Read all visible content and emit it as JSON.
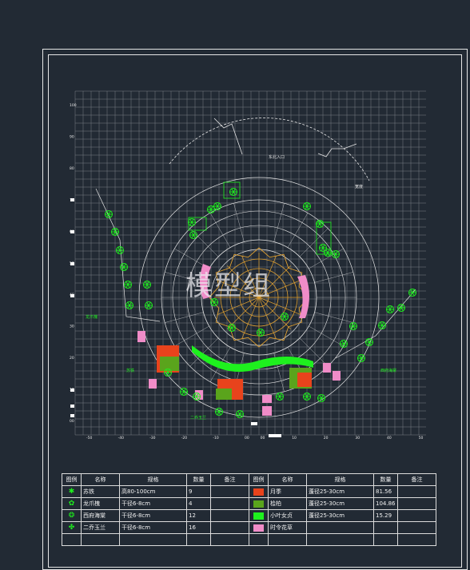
{
  "colors": {
    "background": "#222a34",
    "grid": "#7b7f86",
    "linework": "#e6e6e6",
    "paving": "#e0a030",
    "tree": "#1ef01e",
    "label": "#22ee22",
    "bed_red": "#e8431c",
    "bed_green": "#5aa41c",
    "bed_bright": "#1ef01e",
    "bed_pink": "#f08cc8"
  },
  "watermark": "模型组",
  "plan": {
    "left_axis_ticks": [
      "100",
      "90",
      "80",
      "70",
      "60",
      "50",
      "40",
      "30",
      "20",
      "10",
      "00",
      "-10",
      "-20",
      "-30",
      "-40",
      "-50"
    ],
    "bottom_axis_ticks": [
      "-50",
      "-40",
      "-30",
      "-20",
      "-10",
      "00",
      "00",
      "10",
      "20",
      "30",
      "40",
      "50"
    ],
    "entrance_label": "东北入口",
    "right_note": "宽度",
    "plant_labels": [
      "龙爪槐",
      "苏铁",
      "二乔玉兰",
      "西府海棠"
    ]
  },
  "legend": {
    "headers": [
      "图例",
      "名称",
      "规格",
      "数量",
      "备注",
      "图例",
      "名称",
      "规格",
      "数量",
      "备注"
    ],
    "left_rows": [
      {
        "icon": "sago-palm-icon",
        "glyph": "✱",
        "name": "苏铁",
        "spec": "高80-100cm",
        "qty": "9"
      },
      {
        "icon": "pagoda-tree-icon",
        "glyph": "✿",
        "name": "龙爪槐",
        "spec": "干径6-8cm",
        "qty": "4"
      },
      {
        "icon": "crabapple-icon",
        "glyph": "❂",
        "name": "西府海棠",
        "spec": "干径6-8cm",
        "qty": "12"
      },
      {
        "icon": "magnolia-icon",
        "glyph": "✤",
        "name": "二乔玉兰",
        "spec": "干径6-8cm",
        "qty": "16"
      }
    ],
    "right_rows": [
      {
        "color": "#e8431c",
        "name": "月季",
        "spec": "蓬径25-30cm",
        "qty": "81.56"
      },
      {
        "color": "#5aa41c",
        "name": "桧柏",
        "spec": "蓬径25-30cm",
        "qty": "104.86"
      },
      {
        "color": "#1ef01e",
        "name": "小叶女贞",
        "spec": "蓬径25-30cm",
        "qty": "15.29"
      },
      {
        "color": "#f08cc8",
        "name": "时令花草",
        "spec": "",
        "qty": ""
      }
    ]
  }
}
